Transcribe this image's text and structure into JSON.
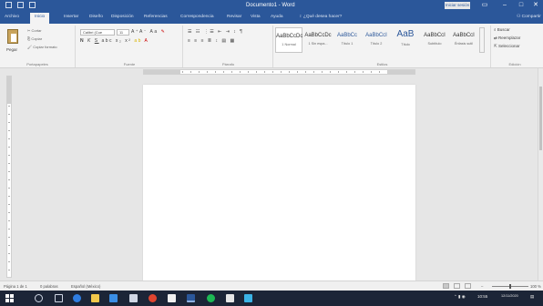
{
  "window": {
    "title": "Documento1 - Word",
    "signin_label": "Iniciar sesión",
    "controls": [
      "minimize-icon",
      "maximize-icon",
      "close-icon"
    ]
  },
  "tabs": [
    "Archivo",
    "Inicio",
    "Insertar",
    "Diseño",
    "Disposición",
    "Referencias",
    "Correspondencia",
    "Revisar",
    "Vista",
    "Ayuda"
  ],
  "active_tab": "Inicio",
  "tell_me": "¿Qué desea hacer?",
  "share_label": "Compartir",
  "ribbon": {
    "clipboard": {
      "label": "Portapapeles",
      "paste": "Pegar",
      "cut": "Cortar",
      "copy": "Copiar",
      "format_painter": "Copiar formato"
    },
    "font": {
      "label": "Fuente",
      "family": "Calibri (Cue",
      "size": "11"
    },
    "paragraph": {
      "label": "Párrafo"
    },
    "styles": {
      "label": "Estilos",
      "items": [
        {
          "sample": "AaBbCcDc",
          "name": "1 Normal"
        },
        {
          "sample": "AaBbCcDc",
          "name": "1 Sin espa..."
        },
        {
          "sample": "AaBbCc",
          "name": "Título 1"
        },
        {
          "sample": "AaBbCcI",
          "name": "Título 2"
        },
        {
          "sample": "AaB",
          "name": "Título"
        },
        {
          "sample": "AaBbCcI",
          "name": "Subtítulo"
        },
        {
          "sample": "AaBbCcI",
          "name": "Énfasis sutil"
        }
      ]
    },
    "editing": {
      "label": "Edición",
      "find": "Buscar",
      "replace": "Reemplazar",
      "select": "Seleccionar"
    }
  },
  "status": {
    "page": "Página 1 de 1",
    "words": "0 palabras",
    "language": "Español (México)",
    "zoom": "100 %"
  },
  "taskbar": {
    "apps": [
      "search-icon",
      "task-view-icon",
      "edge-icon",
      "explorer-icon",
      "store-icon",
      "mail-icon",
      "chrome-icon",
      "photos-icon",
      "word-icon",
      "spotify-icon",
      "settings-icon",
      "app-icon"
    ],
    "time": "10:55",
    "date": "12/11/2020"
  }
}
